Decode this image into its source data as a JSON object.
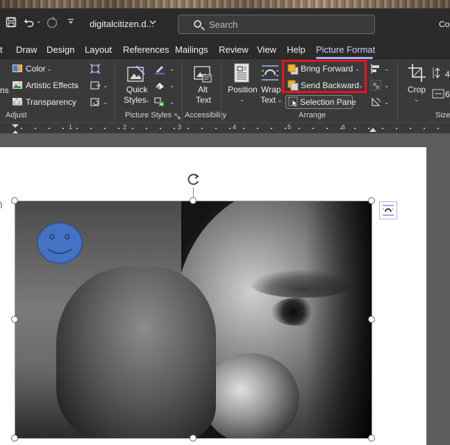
{
  "titlebar": {
    "doc_title": "digitalcitizen.d...",
    "search_placeholder": "Search",
    "account_partial": "Co"
  },
  "tabs": [
    {
      "label": "t"
    },
    {
      "label": "Draw"
    },
    {
      "label": "Design"
    },
    {
      "label": "Layout"
    },
    {
      "label": "References"
    },
    {
      "label": "Mailings"
    },
    {
      "label": "Review"
    },
    {
      "label": "View"
    },
    {
      "label": "Help"
    },
    {
      "label": "Picture Format",
      "active": true
    }
  ],
  "ribbon": {
    "adjust": {
      "color": "Color",
      "artistic_effects": "Artistic Effects",
      "transparency": "Transparency",
      "partial_left": "ns",
      "group_label": "Adjust"
    },
    "picture_styles": {
      "quick_styles_line1": "Quick",
      "quick_styles_line2": "Styles",
      "group_label": "Picture Styles"
    },
    "accessibility": {
      "alt_text_line1": "Alt",
      "alt_text_line2": "Text",
      "group_label": "Accessibility"
    },
    "arrange": {
      "position": "Position",
      "wrap_text_line1": "Wrap",
      "wrap_text_line2": "Text",
      "bring_forward": "Bring Forward",
      "send_backward": "Send Backward",
      "selection_pane": "Selection Pane",
      "group_label": "Arrange"
    },
    "size": {
      "crop": "Crop",
      "height_partial": "4",
      "width_partial": "6",
      "group_label": "Size"
    }
  },
  "ruler": {
    "numbers": [
      "1",
      "2",
      "3",
      "4",
      "5",
      "6"
    ]
  },
  "colors": {
    "highlight": "#e8141d",
    "smiley_fill": "#4472c4",
    "active_tab": "#c9d3ff"
  }
}
